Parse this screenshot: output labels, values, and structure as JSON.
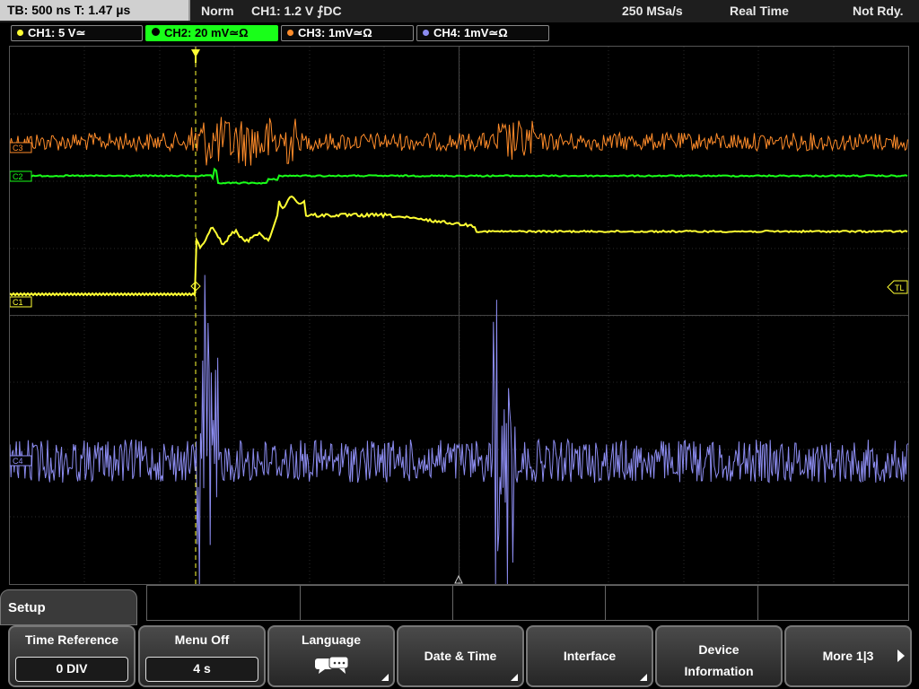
{
  "status": {
    "timebase": "TB: 500 ns   T: 1.47 µs",
    "trigger_mode": "Norm",
    "trigger_info": "CH1: 1.2 V ⨍DC",
    "sample_rate": "250 MSa/s",
    "acq_mode": "Real Time",
    "state": "Not Rdy."
  },
  "channels": [
    {
      "label": "CH1: 5 V≃",
      "color": "#ffff33"
    },
    {
      "label": "CH2: 20 mV≃Ω",
      "color": "#19ff19"
    },
    {
      "label": "CH3: 1mV≃Ω",
      "color": "#ff8c2a"
    },
    {
      "label": "CH4: 1mV≃Ω",
      "color": "#8c8cf0"
    }
  ],
  "markers": {
    "c3": "C3",
    "c2": "C2",
    "c1": "C1",
    "c4": "C4",
    "trigger_level": "TL"
  },
  "menu": {
    "title": "Setup",
    "time_reference": {
      "label": "Time Reference",
      "value": "0 DIV"
    },
    "menu_off": {
      "label": "Menu Off",
      "value": "4 s"
    },
    "language": {
      "label": "Language",
      "icon": "speech-bubbles-icon"
    },
    "date_time": {
      "label": "Date & Time"
    },
    "interface": {
      "label": "Interface"
    },
    "device_info": {
      "line1": "Device",
      "line2": "Information"
    },
    "more": {
      "label": "More 1|3"
    }
  }
}
